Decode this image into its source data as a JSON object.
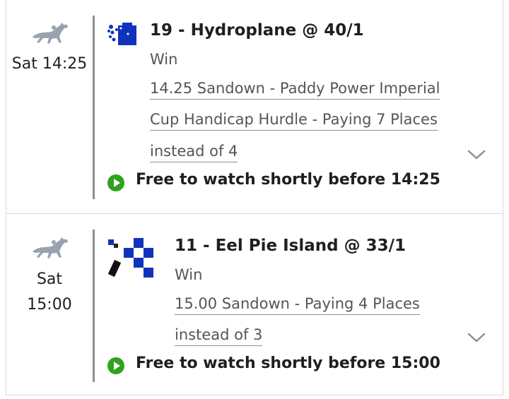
{
  "bets": [
    {
      "time": "Sat 14:25",
      "title": "19 - Hydroplane @ 40/1",
      "bet_type": "Win",
      "market_lines": [
        "14.25 Sandown - Paddy Power Imperial",
        "Cup Handicap Hurdle - Paying 7 Places",
        "instead of 4"
      ],
      "watch_text": "Free to watch shortly before 14:25"
    },
    {
      "time_line1": "Sat",
      "time_line2": "15:00",
      "title": "11 - Eel Pie Island @ 33/1",
      "bet_type": "Win",
      "market_lines": [
        "15.00 Sandown - Paying 4 Places",
        "instead of 3"
      ],
      "watch_text": "Free to watch shortly before 15:00"
    }
  ],
  "colors": {
    "play_green": "#2fa21f",
    "silk_blue": "#1133bb",
    "horse_grey": "#9aa2b0",
    "chevron": "#8a9099"
  },
  "icons": [
    "horse-racing-icon",
    "jockey-silk-icon",
    "play-icon",
    "chevron-down-icon"
  ]
}
